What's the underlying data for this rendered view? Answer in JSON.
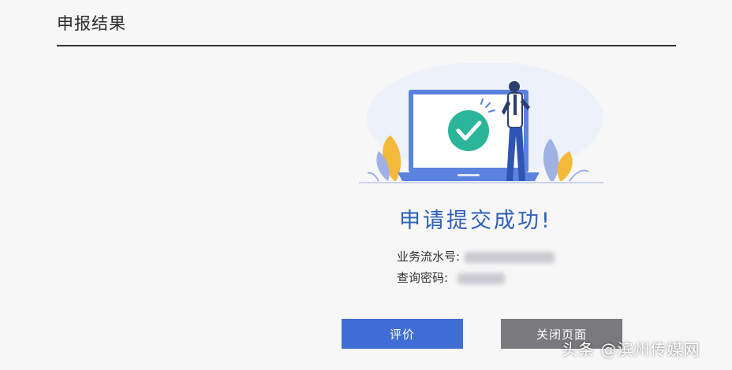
{
  "page": {
    "title": "申报结果"
  },
  "result": {
    "message": "申请提交成功!",
    "serial_label": "业务流水号:",
    "serial_value": "",
    "password_label": "查询密码:",
    "password_value": ""
  },
  "actions": {
    "rate_label": "评价",
    "close_label": "关闭页面"
  },
  "watermark": {
    "text": "头条 @滨州传媒网"
  },
  "colors": {
    "accent": "#3f6fd6",
    "success_text": "#2f5fb8",
    "check_circle": "#2bb59a",
    "close_button": "#7a7a7e"
  },
  "icons": {
    "success_illustration": "laptop-checkmark-person-illustration",
    "check": "check-icon"
  }
}
